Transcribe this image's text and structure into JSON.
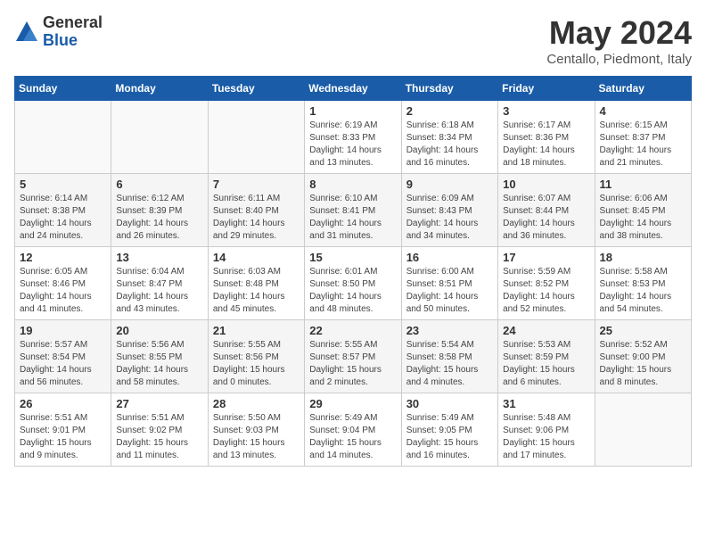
{
  "logo": {
    "general": "General",
    "blue": "Blue"
  },
  "title": "May 2024",
  "location": "Centallo, Piedmont, Italy",
  "days_of_week": [
    "Sunday",
    "Monday",
    "Tuesday",
    "Wednesday",
    "Thursday",
    "Friday",
    "Saturday"
  ],
  "weeks": [
    [
      {
        "day": "",
        "info": ""
      },
      {
        "day": "",
        "info": ""
      },
      {
        "day": "",
        "info": ""
      },
      {
        "day": "1",
        "info": "Sunrise: 6:19 AM\nSunset: 8:33 PM\nDaylight: 14 hours\nand 13 minutes."
      },
      {
        "day": "2",
        "info": "Sunrise: 6:18 AM\nSunset: 8:34 PM\nDaylight: 14 hours\nand 16 minutes."
      },
      {
        "day": "3",
        "info": "Sunrise: 6:17 AM\nSunset: 8:36 PM\nDaylight: 14 hours\nand 18 minutes."
      },
      {
        "day": "4",
        "info": "Sunrise: 6:15 AM\nSunset: 8:37 PM\nDaylight: 14 hours\nand 21 minutes."
      }
    ],
    [
      {
        "day": "5",
        "info": "Sunrise: 6:14 AM\nSunset: 8:38 PM\nDaylight: 14 hours\nand 24 minutes."
      },
      {
        "day": "6",
        "info": "Sunrise: 6:12 AM\nSunset: 8:39 PM\nDaylight: 14 hours\nand 26 minutes."
      },
      {
        "day": "7",
        "info": "Sunrise: 6:11 AM\nSunset: 8:40 PM\nDaylight: 14 hours\nand 29 minutes."
      },
      {
        "day": "8",
        "info": "Sunrise: 6:10 AM\nSunset: 8:41 PM\nDaylight: 14 hours\nand 31 minutes."
      },
      {
        "day": "9",
        "info": "Sunrise: 6:09 AM\nSunset: 8:43 PM\nDaylight: 14 hours\nand 34 minutes."
      },
      {
        "day": "10",
        "info": "Sunrise: 6:07 AM\nSunset: 8:44 PM\nDaylight: 14 hours\nand 36 minutes."
      },
      {
        "day": "11",
        "info": "Sunrise: 6:06 AM\nSunset: 8:45 PM\nDaylight: 14 hours\nand 38 minutes."
      }
    ],
    [
      {
        "day": "12",
        "info": "Sunrise: 6:05 AM\nSunset: 8:46 PM\nDaylight: 14 hours\nand 41 minutes."
      },
      {
        "day": "13",
        "info": "Sunrise: 6:04 AM\nSunset: 8:47 PM\nDaylight: 14 hours\nand 43 minutes."
      },
      {
        "day": "14",
        "info": "Sunrise: 6:03 AM\nSunset: 8:48 PM\nDaylight: 14 hours\nand 45 minutes."
      },
      {
        "day": "15",
        "info": "Sunrise: 6:01 AM\nSunset: 8:50 PM\nDaylight: 14 hours\nand 48 minutes."
      },
      {
        "day": "16",
        "info": "Sunrise: 6:00 AM\nSunset: 8:51 PM\nDaylight: 14 hours\nand 50 minutes."
      },
      {
        "day": "17",
        "info": "Sunrise: 5:59 AM\nSunset: 8:52 PM\nDaylight: 14 hours\nand 52 minutes."
      },
      {
        "day": "18",
        "info": "Sunrise: 5:58 AM\nSunset: 8:53 PM\nDaylight: 14 hours\nand 54 minutes."
      }
    ],
    [
      {
        "day": "19",
        "info": "Sunrise: 5:57 AM\nSunset: 8:54 PM\nDaylight: 14 hours\nand 56 minutes."
      },
      {
        "day": "20",
        "info": "Sunrise: 5:56 AM\nSunset: 8:55 PM\nDaylight: 14 hours\nand 58 minutes."
      },
      {
        "day": "21",
        "info": "Sunrise: 5:55 AM\nSunset: 8:56 PM\nDaylight: 15 hours\nand 0 minutes."
      },
      {
        "day": "22",
        "info": "Sunrise: 5:55 AM\nSunset: 8:57 PM\nDaylight: 15 hours\nand 2 minutes."
      },
      {
        "day": "23",
        "info": "Sunrise: 5:54 AM\nSunset: 8:58 PM\nDaylight: 15 hours\nand 4 minutes."
      },
      {
        "day": "24",
        "info": "Sunrise: 5:53 AM\nSunset: 8:59 PM\nDaylight: 15 hours\nand 6 minutes."
      },
      {
        "day": "25",
        "info": "Sunrise: 5:52 AM\nSunset: 9:00 PM\nDaylight: 15 hours\nand 8 minutes."
      }
    ],
    [
      {
        "day": "26",
        "info": "Sunrise: 5:51 AM\nSunset: 9:01 PM\nDaylight: 15 hours\nand 9 minutes."
      },
      {
        "day": "27",
        "info": "Sunrise: 5:51 AM\nSunset: 9:02 PM\nDaylight: 15 hours\nand 11 minutes."
      },
      {
        "day": "28",
        "info": "Sunrise: 5:50 AM\nSunset: 9:03 PM\nDaylight: 15 hours\nand 13 minutes."
      },
      {
        "day": "29",
        "info": "Sunrise: 5:49 AM\nSunset: 9:04 PM\nDaylight: 15 hours\nand 14 minutes."
      },
      {
        "day": "30",
        "info": "Sunrise: 5:49 AM\nSunset: 9:05 PM\nDaylight: 15 hours\nand 16 minutes."
      },
      {
        "day": "31",
        "info": "Sunrise: 5:48 AM\nSunset: 9:06 PM\nDaylight: 15 hours\nand 17 minutes."
      },
      {
        "day": "",
        "info": ""
      }
    ]
  ]
}
